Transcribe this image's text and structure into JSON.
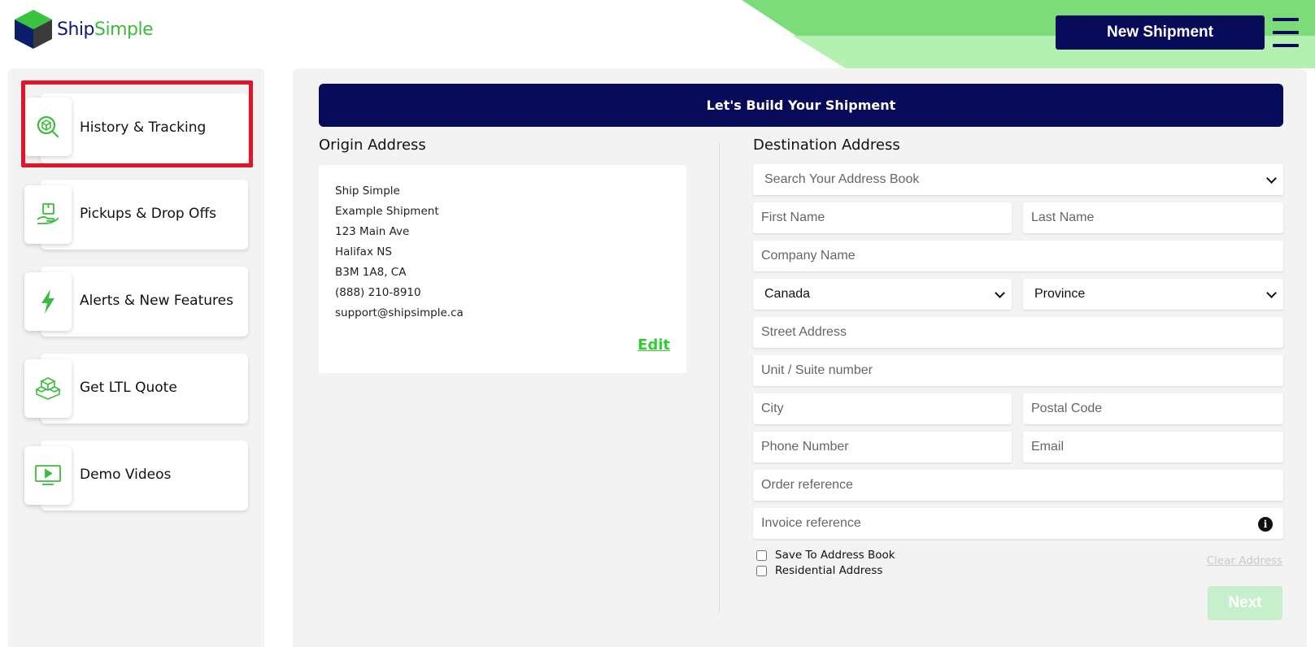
{
  "brand": {
    "name_part1": "Ship",
    "name_part2": "Simple"
  },
  "header": {
    "new_shipment_label": "New Shipment"
  },
  "colors": {
    "navy": "#080a5a",
    "green": "#3dbb3d",
    "light_green": "#a5eba5",
    "highlight_red": "#e0142b"
  },
  "sidebar": {
    "items": [
      {
        "label": "History & Tracking",
        "icon": "magnifier-box-icon"
      },
      {
        "label": "Pickups & Drop Offs",
        "icon": "hand-package-icon"
      },
      {
        "label": "Alerts & New Features",
        "icon": "lightning-icon"
      },
      {
        "label": "Get LTL Quote",
        "icon": "pallet-boxes-icon"
      },
      {
        "label": "Demo Videos",
        "icon": "video-screen-icon"
      }
    ]
  },
  "main": {
    "banner": "Let's Build Your Shipment",
    "origin": {
      "title": "Origin Address",
      "lines": [
        "Ship Simple",
        "Example Shipment",
        "123 Main Ave",
        "Halifax NS",
        "B3M 1A8, CA",
        "(888) 210-8910",
        "support@shipsimple.ca"
      ],
      "edit_label": "Edit"
    },
    "destination": {
      "title": "Destination Address",
      "address_book_placeholder": "Search Your Address Book",
      "first_name_placeholder": "First Name",
      "last_name_placeholder": "Last Name",
      "company_placeholder": "Company Name",
      "country_value": "Canada",
      "province_value": "Province",
      "street_placeholder": "Street Address",
      "unit_placeholder": "Unit / Suite number",
      "city_placeholder": "City",
      "postal_placeholder": "Postal Code",
      "phone_placeholder": "Phone Number",
      "email_placeholder": "Email",
      "order_ref_placeholder": "Order reference",
      "invoice_ref_placeholder": "Invoice reference",
      "save_label": "Save To Address Book",
      "residential_label": "Residential Address",
      "clear_label": "Clear Address",
      "next_label": "Next"
    }
  }
}
